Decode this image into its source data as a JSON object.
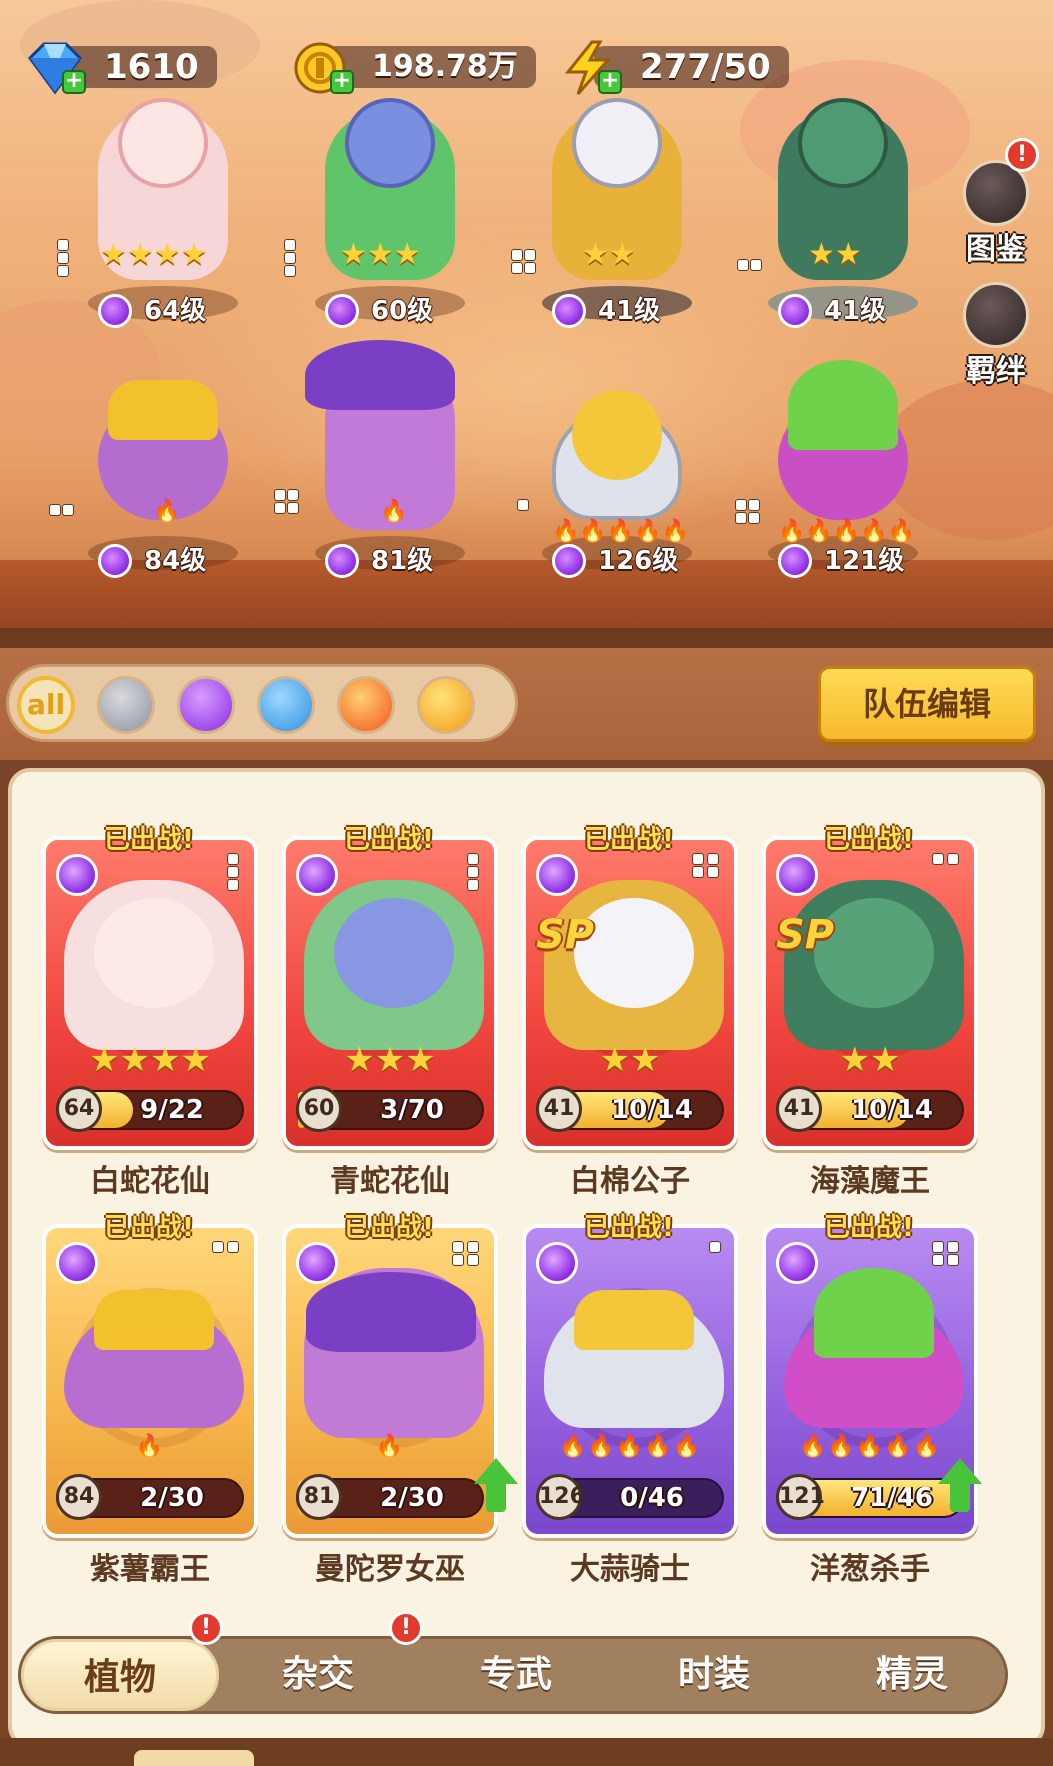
{
  "resources": {
    "gems": "1610",
    "coins": "198.78万",
    "energy": "277/50"
  },
  "side_buttons": {
    "codex": "图鉴",
    "bond": "羁绊",
    "codex_badge": "!"
  },
  "field_heroes": [
    {
      "level": "64级",
      "stars": "★★★★"
    },
    {
      "level": "60级",
      "stars": "★★★"
    },
    {
      "level": "41级",
      "stars": "★★"
    },
    {
      "level": "41级",
      "stars": "★★"
    },
    {
      "level": "84级",
      "flames": "🔥"
    },
    {
      "level": "81级",
      "flames": "🔥"
    },
    {
      "level": "126级",
      "flames": "🔥🔥🔥🔥🔥"
    },
    {
      "level": "121级",
      "flames": "🔥🔥🔥🔥🔥"
    }
  ],
  "filter": {
    "all_label": "all",
    "team_edit": "队伍编辑"
  },
  "cards": [
    {
      "name": "白蛇花仙",
      "level": "64",
      "progress": "9/22",
      "fill": 0.41,
      "deployed": "已出战!",
      "stars": "★★★★",
      "color": "red",
      "sp": ""
    },
    {
      "name": "青蛇花仙",
      "level": "60",
      "progress": "3/70",
      "fill": 0.04,
      "deployed": "已出战!",
      "stars": "★★★",
      "color": "red",
      "sp": ""
    },
    {
      "name": "白棉公子",
      "level": "41",
      "progress": "10/14",
      "fill": 0.71,
      "deployed": "已出战!",
      "stars": "★★",
      "color": "red",
      "sp": "SP"
    },
    {
      "name": "海藻魔王",
      "level": "41",
      "progress": "10/14",
      "fill": 0.71,
      "deployed": "已出战!",
      "stars": "★★",
      "color": "red",
      "sp": "SP"
    },
    {
      "name": "紫薯霸王",
      "level": "84",
      "progress": "2/30",
      "fill": 0.07,
      "deployed": "已出战!",
      "flames": "🔥",
      "color": "gold"
    },
    {
      "name": "曼陀罗女巫",
      "level": "81",
      "progress": "2/30",
      "fill": 0.07,
      "deployed": "已出战!",
      "flames": "🔥",
      "color": "gold"
    },
    {
      "name": "大蒜骑士",
      "level": "126",
      "progress": "0/46",
      "fill": 0.0,
      "deployed": "已出战!",
      "flames": "🔥🔥🔥🔥🔥",
      "color": "purple"
    },
    {
      "name": "洋葱杀手",
      "level": "121",
      "progress": "71/46",
      "fill": 1.0,
      "deployed": "已出战!",
      "flames": "🔥🔥🔥🔥🔥",
      "color": "purple"
    }
  ],
  "tabs": [
    {
      "label": "植物",
      "active": true,
      "badge": "!"
    },
    {
      "label": "杂交",
      "active": false,
      "badge": "!"
    },
    {
      "label": "专武",
      "active": false
    },
    {
      "label": "时装",
      "active": false
    },
    {
      "label": "精灵",
      "active": false
    }
  ],
  "colors": {
    "accent_gold": "#f6b92c",
    "card_red": "#f0463e",
    "card_gold": "#f6b64c",
    "card_purple": "#9260dd",
    "badge_red": "#e23b2e",
    "upgrade_green": "#49c43a"
  },
  "icons": {
    "gems": "blue-diamond-icon",
    "coins": "gold-coin-icon",
    "energy": "lightning-bolt-icon",
    "filters": [
      "all",
      "sword-icon",
      "potion-icon",
      "water-drop-icon",
      "fire-icon",
      "lightning-icon"
    ]
  }
}
